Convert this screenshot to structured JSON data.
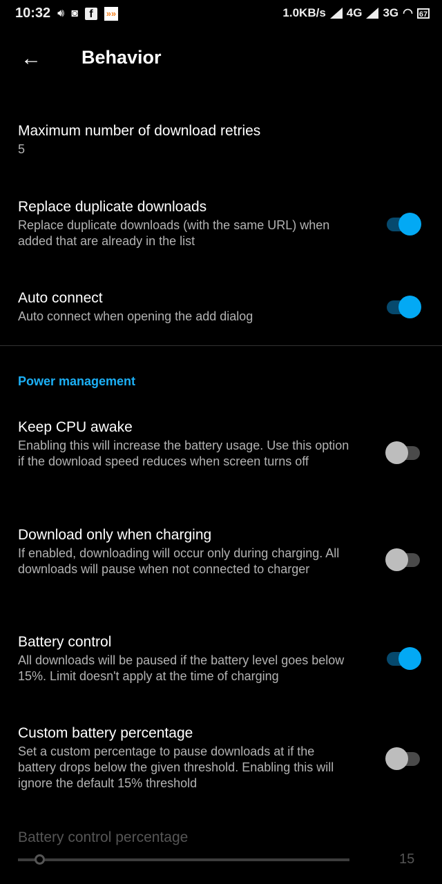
{
  "status_bar": {
    "time": "10:32",
    "net_speed": "1.0KB/s",
    "net1": "4G",
    "net2": "3G",
    "battery": "67"
  },
  "app_bar": {
    "title": "Behavior",
    "back_icon": "arrow-left-icon"
  },
  "prefs": [
    {
      "title": "Maximum number of download retries",
      "summary": "5"
    },
    {
      "title": "Replace duplicate downloads",
      "summary": "Replace duplicate downloads (with the same URL) when added that are already in the list",
      "checked": true
    },
    {
      "title": "Auto connect",
      "summary": "Auto connect when opening the add dialog",
      "checked": true
    }
  ],
  "category": "Power management",
  "power_prefs": [
    {
      "title": "Keep CPU awake",
      "summary": "Enabling this will increase the battery usage. Use this option if the download speed reduces when screen turns off",
      "checked": false
    },
    {
      "title": "Download only when charging",
      "summary": "If enabled, downloading will occur only during charging. All downloads will pause when not connected to charger",
      "checked": false
    },
    {
      "title": "Battery control",
      "summary": "All downloads will be paused if the battery level goes below 15%. Limit doesn't apply at the time of charging",
      "checked": true
    },
    {
      "title": "Custom battery percentage",
      "summary": "Set a custom percentage to pause downloads at if the battery drops below the given threshold. Enabling this will ignore the default 15% threshold",
      "checked": false
    }
  ],
  "slider": {
    "title": "Battery control percentage",
    "value": "15",
    "enabled": false
  }
}
